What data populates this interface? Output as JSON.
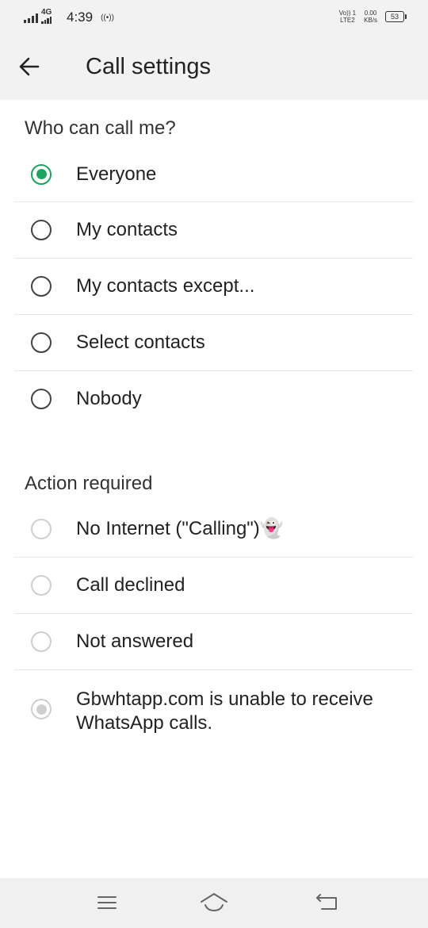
{
  "status_bar": {
    "network_type": "4G",
    "time": "4:39",
    "hotspot_symbol": "((•))",
    "volte_line1": "Vo)) 1",
    "volte_line2": "LTE2",
    "speed_value": "0.00",
    "speed_unit": "KB/s",
    "battery_level": "53"
  },
  "app_bar": {
    "back_icon": "arrow-left-icon",
    "title": "Call settings"
  },
  "who_can_call": {
    "title": "Who can call me?",
    "options": [
      {
        "label": "Everyone",
        "checked": true
      },
      {
        "label": "My contacts",
        "checked": false
      },
      {
        "label": "My contacts except...",
        "checked": false
      },
      {
        "label": "Select contacts",
        "checked": false
      },
      {
        "label": "Nobody",
        "checked": false
      }
    ]
  },
  "action_required": {
    "title": "Action required",
    "options": [
      {
        "label": "No Internet (\"Calling\")👻",
        "checked": false
      },
      {
        "label": "Call declined",
        "checked": false
      },
      {
        "label": "Not answered",
        "checked": false
      },
      {
        "label": "Gbwhtapp.com is unable to receive WhatsApp calls.",
        "checked": true
      }
    ]
  },
  "nav_bar": {
    "menu_icon": "menu-icon",
    "home_icon": "home-icon",
    "back_icon": "back-icon"
  },
  "colors": {
    "accent": "#1ea362",
    "header_bg": "#f2f2f2",
    "divider": "#e7e7e7",
    "disabled_radio": "#cfcfcf"
  }
}
